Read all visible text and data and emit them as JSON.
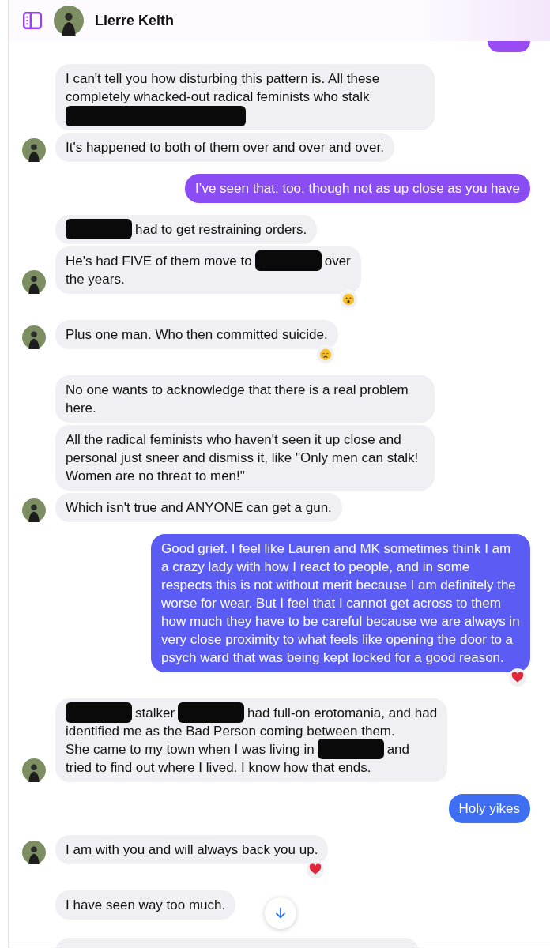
{
  "header": {
    "contact_name": "Lierre Keith"
  },
  "messages": [
    {
      "kind": "clipped",
      "sent": true,
      "color": "#9a4cf3"
    },
    {
      "kind": "text",
      "sent": false,
      "avatar": false,
      "lines": [
        [
          {
            "kind": "text",
            "text": "I can't tell you how disturbing this pattern is. All these completely whacked-out radical feminists who stalk"
          }
        ],
        [
          {
            "kind": "redaction",
            "wide": true
          }
        ]
      ]
    },
    {
      "kind": "text",
      "sent": false,
      "avatar": true,
      "lines": [
        [
          {
            "kind": "text",
            "text": "It's happened to both of them over and over and over."
          }
        ]
      ]
    },
    {
      "kind": "text",
      "sent": true,
      "color": "#8a4df4",
      "lines": [
        [
          {
            "kind": "text",
            "text": "I’ve seen that, too, though not as up close as you have"
          }
        ]
      ]
    },
    {
      "kind": "text",
      "sent": false,
      "avatar": false,
      "lines": [
        [
          {
            "kind": "redaction",
            "wide": false
          },
          {
            "kind": "text",
            "text": "had to get restraining orders."
          }
        ]
      ]
    },
    {
      "kind": "text",
      "sent": false,
      "avatar": true,
      "reaction": {
        "kind": "wow"
      },
      "lines": [
        [
          {
            "kind": "text",
            "text": "He's had FIVE of them move to"
          },
          {
            "kind": "redaction",
            "wide": false
          },
          {
            "kind": "text",
            "text": "over"
          }
        ],
        [
          {
            "kind": "text",
            "text": "the years."
          }
        ]
      ]
    },
    {
      "kind": "text",
      "sent": false,
      "avatar": true,
      "reaction": {
        "kind": "cry"
      },
      "lines": [
        [
          {
            "kind": "text",
            "text": "Plus one man. Who then committed suicide."
          }
        ]
      ]
    },
    {
      "kind": "text",
      "sent": false,
      "avatar": false,
      "lines": [
        [
          {
            "kind": "text",
            "text": "No one wants to acknowledge that there is a real problem here."
          }
        ]
      ]
    },
    {
      "kind": "text",
      "sent": false,
      "avatar": false,
      "lines": [
        [
          {
            "kind": "text",
            "text": "All the radical feminists who haven't seen it up close and personal just sneer and dismiss it, like \"Only men can stalk! Women are no threat to men!\""
          }
        ]
      ]
    },
    {
      "kind": "text",
      "sent": false,
      "avatar": true,
      "lines": [
        [
          {
            "kind": "text",
            "text": "Which isn't true and ANYONE can get a gun."
          }
        ]
      ]
    },
    {
      "kind": "text",
      "sent": true,
      "color": "#5a5cf3",
      "reaction": {
        "kind": "heart"
      },
      "lines": [
        [
          {
            "kind": "text",
            "text": "Good grief. I feel like Lauren and MK sometimes think I am a crazy lady with how I react to people, and in some respects this is not without merit because I am definitely the worse for wear. But I feel that I cannot get across to them how much they have to be careful because we are always in very close proximity to what feels like opening the door to a psych ward that was being kept locked for a good reason."
          }
        ]
      ]
    },
    {
      "kind": "text",
      "sent": false,
      "avatar": true,
      "lines": [
        [
          {
            "kind": "redaction",
            "wide": false
          },
          {
            "kind": "text",
            "text": "stalker"
          },
          {
            "kind": "redaction",
            "wide": false
          },
          {
            "kind": "text",
            "text": "had full-on erotomania, and had"
          }
        ],
        [
          {
            "kind": "text",
            "text": "identified me as the Bad Person coming between them."
          }
        ],
        [
          {
            "kind": "text",
            "text": "She came to my town when I was living in"
          },
          {
            "kind": "redaction",
            "wide": false
          },
          {
            "kind": "text",
            "text": "and"
          }
        ],
        [
          {
            "kind": "text",
            "text": "tried to find out where I lived. I know how that ends."
          }
        ]
      ]
    },
    {
      "kind": "text",
      "sent": true,
      "color": "#3e6ff3",
      "lines": [
        [
          {
            "kind": "text",
            "text": "Holy yikes"
          }
        ]
      ]
    },
    {
      "kind": "text",
      "sent": false,
      "avatar": true,
      "reaction": {
        "kind": "heart"
      },
      "lines": [
        [
          {
            "kind": "text",
            "text": "I am with you and will always back you up."
          }
        ]
      ]
    },
    {
      "kind": "text",
      "sent": false,
      "avatar": false,
      "lines": [
        [
          {
            "kind": "text",
            "text": "I have seen way too much."
          }
        ]
      ]
    },
    {
      "kind": "clipped",
      "sent": false,
      "avatar": false
    }
  ]
}
